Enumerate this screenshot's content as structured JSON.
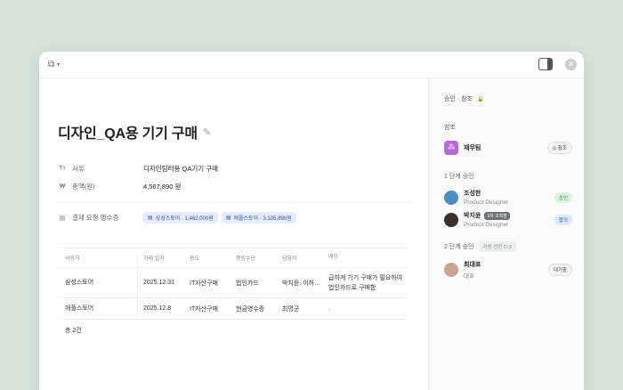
{
  "document": {
    "title": "디자인_QA용 기기 구매",
    "properties": [
      {
        "icon": "text-icon",
        "icon_glyph": "Tт",
        "label": "사유",
        "value": "디자인팀터용 QA기기 구매"
      },
      {
        "icon": "won-icon",
        "icon_glyph": "₩",
        "label": "총액(원)",
        "value": "4,567,890 원"
      },
      {
        "icon": "receipt-icon",
        "icon_glyph": "▤",
        "label": "결제 요청 영수증"
      }
    ],
    "receipt_chips": [
      "삼성스토어 · 1,462,000원",
      "애플스토어 · 3,105,890원"
    ]
  },
  "table": {
    "headers": [
      "사용처",
      "거래 일자",
      "용도",
      "증빙수단",
      "담당자",
      "메모"
    ],
    "rows": [
      [
        "삼성스토어",
        "2025.12.31",
        "IT자산구매",
        "법인카드",
        "박지윤, 이하니, ...",
        "급하게 기기 구매가 필요하여 법인카드로 구매함"
      ],
      [
        "애플스토어",
        "2025.12.8",
        "IT자산구매",
        "현금영수증",
        "최명군",
        "."
      ]
    ],
    "total": "총 2건"
  },
  "sidebar": {
    "header": "승인 · 참조",
    "reference_label": "참조",
    "reference": {
      "name": "재무팀",
      "badge": "◎ 참조"
    },
    "step1_label": "1 단계 승인",
    "step1": [
      {
        "name": "조성한",
        "role": "Product Designer",
        "badge": "승인",
        "tag": ""
      },
      {
        "name": "박지윤",
        "role": "Product Designer",
        "badge": "합의",
        "tag": "3차 조직장"
      }
    ],
    "step2_label": "2 단계 승인",
    "step2_sub": "자동 전환 D-3",
    "step2": [
      {
        "name": "최대표",
        "role": "대표",
        "badge": "대기중"
      }
    ]
  },
  "colors": {
    "background": "#d6e2dc",
    "chip": "#e6ecfb",
    "approved": "#dcf2e1",
    "agreed": "#dde8fb",
    "team": "#b46bd8"
  }
}
